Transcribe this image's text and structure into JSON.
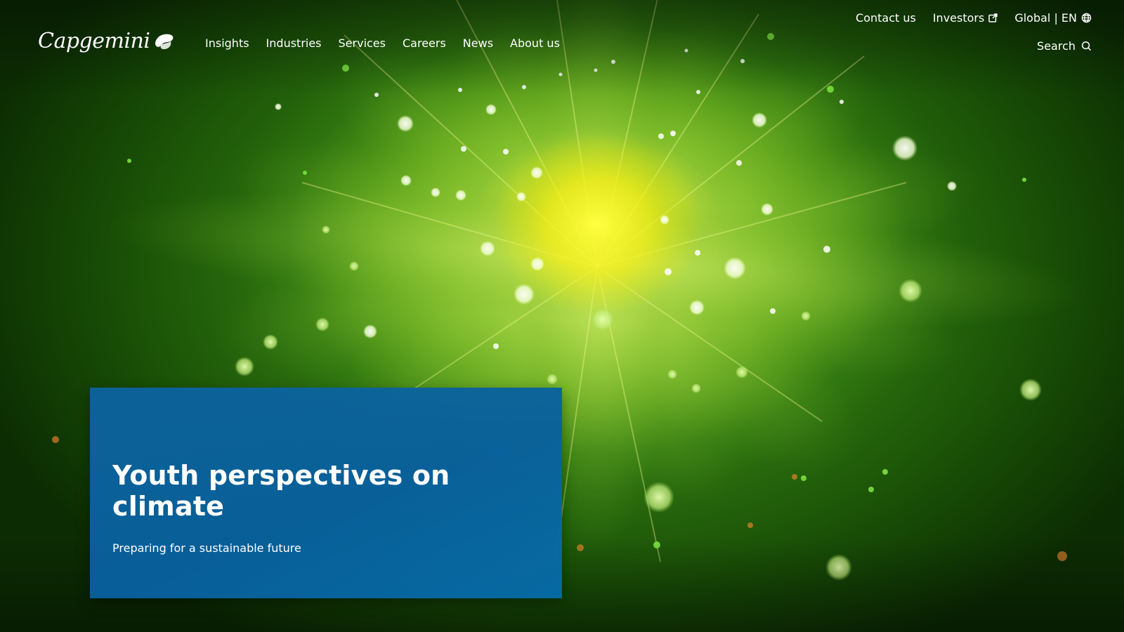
{
  "brand": {
    "name": "Capgemini",
    "accent_color": "#0070ad"
  },
  "utility_nav": {
    "contact": "Contact us",
    "investors": "Investors",
    "region": "Global | EN"
  },
  "main_nav": {
    "items": [
      {
        "label": "Insights"
      },
      {
        "label": "Industries"
      },
      {
        "label": "Services"
      },
      {
        "label": "Careers"
      },
      {
        "label": "News"
      },
      {
        "label": "About us"
      }
    ]
  },
  "search": {
    "label": "Search"
  },
  "hero": {
    "title": "Youth perspectives on climate",
    "subtitle": "Preparing for a sustainable future"
  },
  "icons": {
    "external_link": "external-link-icon",
    "globe": "globe-icon",
    "search": "search-icon",
    "logo_mark": "capgemini-spade-icon"
  }
}
